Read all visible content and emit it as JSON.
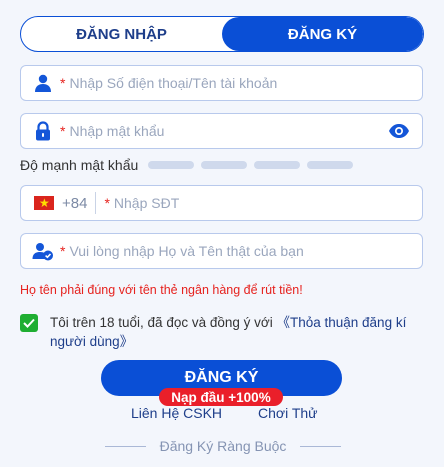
{
  "tabs": {
    "login": "ĐĂNG NHẬP",
    "register": "ĐĂNG KÝ"
  },
  "form": {
    "required_mark": "*",
    "account_placeholder": "Nhập Số điện thoại/Tên tài khoản",
    "password_placeholder": "Nhập mật khẩu",
    "strength_label": "Độ mạnh mật khẩu",
    "country_code": "+84",
    "phone_placeholder": "Nhập SĐT",
    "name_placeholder": "Vui lòng nhập Họ và Tên thật của bạn",
    "name_warning": "Họ tên phải đúng với tên thẻ ngân hàng để rút tiền!"
  },
  "agreement": {
    "checked": true,
    "text": "Tôi trên 18 tuổi, đã đọc và đồng ý với ",
    "link": "《Thỏa thuận đăng kí người dùng》"
  },
  "actions": {
    "submit": "ĐĂNG KÝ",
    "bonus_badge": "Nạp đầu +100%",
    "support_link": "Liên Hệ CSKH",
    "try_link": "Chơi Thử",
    "bind_link": "Đăng Ký Ràng Buộc"
  },
  "colors": {
    "primary": "#0a4fd6",
    "error": "#e6231f",
    "check": "#1fae32",
    "background": "#f3f6fc"
  },
  "icons": [
    "user-icon",
    "lock-icon",
    "eye-icon",
    "vietnam-flag-icon",
    "user-verified-icon",
    "checkmark-icon"
  ]
}
